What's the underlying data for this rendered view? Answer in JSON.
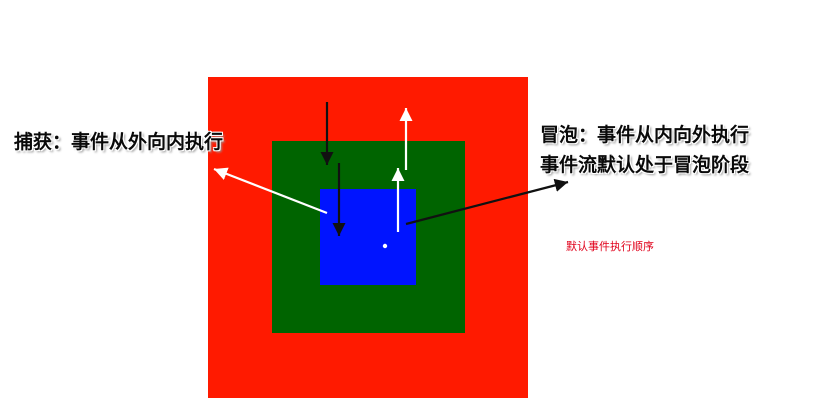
{
  "colors": {
    "outer_box": "#ff1a00",
    "middle_box": "#006400",
    "inner_box": "#0014ff",
    "capture_arrow": "#111111",
    "bubble_arrow": "#ffffff",
    "pointer_arrow_capture": "#ffffff",
    "pointer_arrow_bubble": "#111111",
    "note_text": "#e0001a"
  },
  "labels": {
    "capture": "捕获：事件从外向内执行",
    "bubble": "冒泡：事件从内向外执行",
    "bubble_default": "事件流默认处于冒泡阶段",
    "order_note": "默认事件执行顺序"
  }
}
